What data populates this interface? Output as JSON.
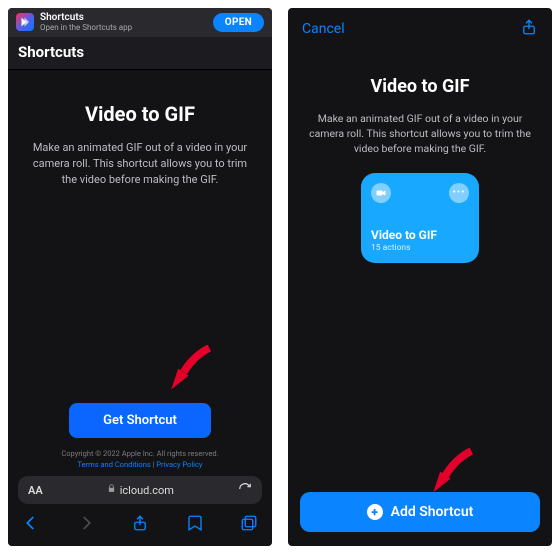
{
  "banner": {
    "app_name": "Shortcuts",
    "app_sub": "Open in the Shortcuts app",
    "open_label": "OPEN"
  },
  "nav1": {
    "title": "Shortcuts"
  },
  "page1": {
    "title": "Video to GIF",
    "description": "Make an animated GIF out of a video in your camera roll. This shortcut allows you to trim the video before making the GIF.",
    "get_label": "Get Shortcut",
    "legal_copyright": "Copyright © 2022 Apple Inc. All rights reserved.",
    "legal_terms": "Terms and Conditions",
    "legal_sep": " | ",
    "legal_privacy": "Privacy Policy"
  },
  "safari": {
    "aA": "AA",
    "lock": "🔒",
    "domain": "icloud.com",
    "refresh": "↻"
  },
  "nav2": {
    "cancel": "Cancel"
  },
  "page2": {
    "title": "Video to GIF",
    "description": "Make an animated GIF out of a video in your camera roll. This shortcut allows you to trim the video before making the GIF.",
    "card_title": "Video to GIF",
    "card_sub": "15 actions",
    "add_label": "Add Shortcut"
  }
}
